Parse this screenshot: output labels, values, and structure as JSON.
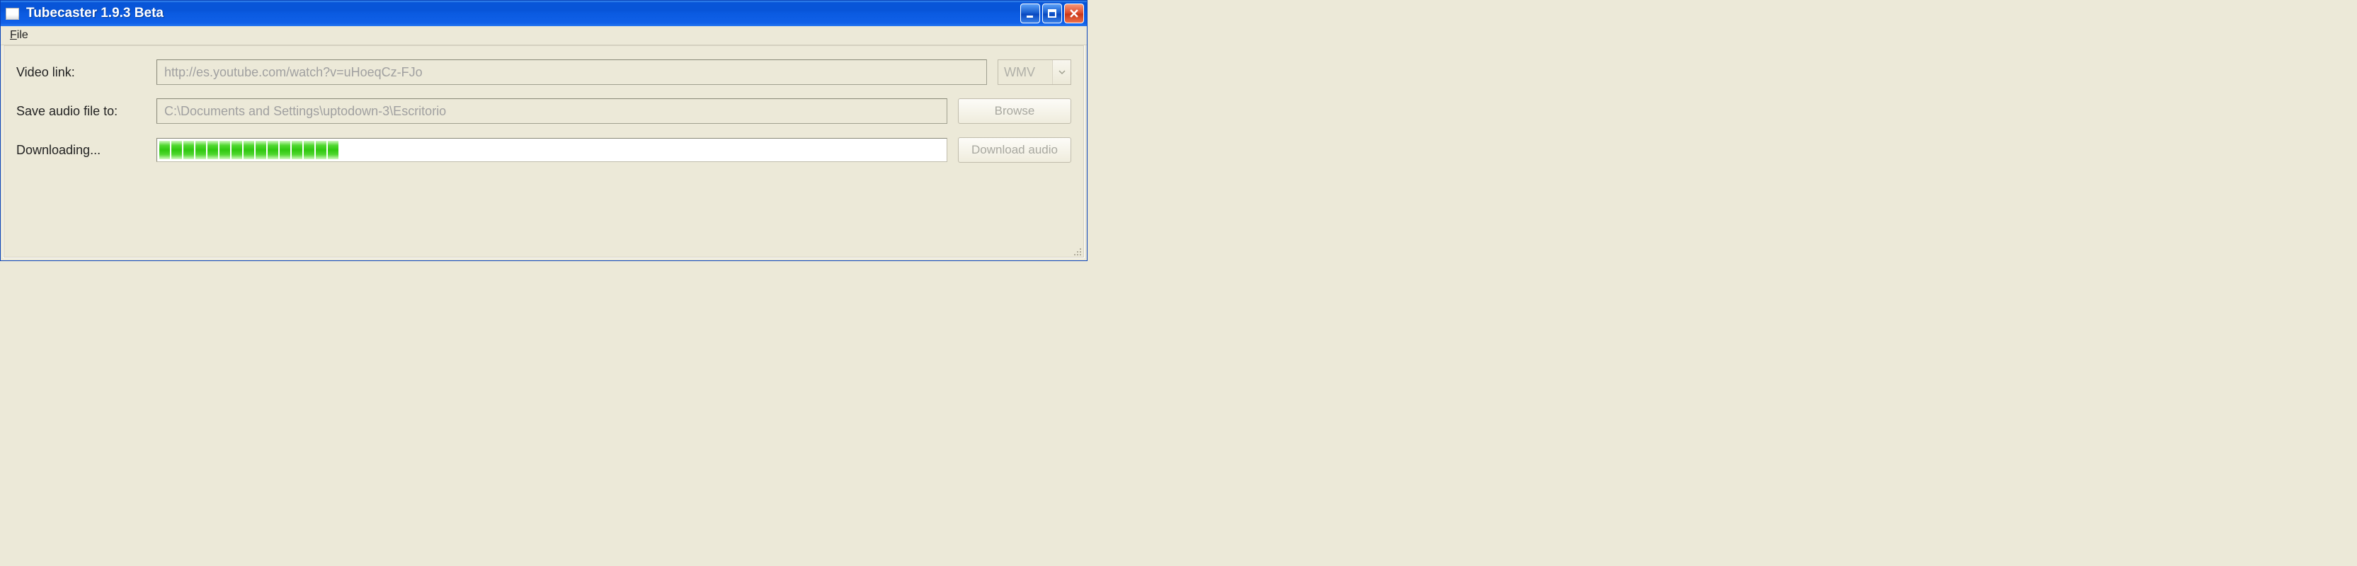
{
  "title": "Tubecaster 1.9.3 Beta",
  "menubar": {
    "file": "File"
  },
  "form": {
    "video_link_label": "Video link:",
    "video_link_value": "http://es.youtube.com/watch?v=uHoeqCz-FJo",
    "format_selected": "WMV",
    "save_to_label": "Save audio file to:",
    "save_to_value": "C:\\Documents and Settings\\uptodown-3\\Escritorio",
    "browse_label": "Browse",
    "status_label": "Downloading...",
    "download_label": "Download audio"
  },
  "progress": {
    "blocks": 15
  }
}
